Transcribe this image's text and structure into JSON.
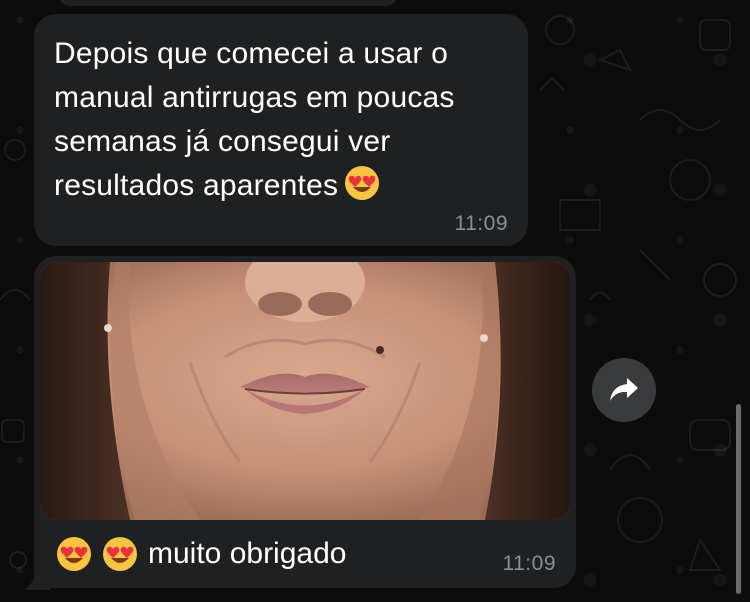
{
  "chat": {
    "messages": [
      {
        "text": "Depois que comecei a usar o manual antirrugas em poucas semanas já consegui ver resultados aparentes",
        "emoji": "smiling-face-with-heart-eyes",
        "time": "11:09"
      },
      {
        "type": "image",
        "caption_emojis": [
          "smiling-face-with-heart-eyes",
          "smiling-face-with-heart-eyes"
        ],
        "caption": "muito obrigado",
        "time": "11:09"
      }
    ],
    "forward_icon": "forward-arrow-icon"
  },
  "colors": {
    "bubble": "#1f2021",
    "text": "#ffffff",
    "timestamp": "#8d8f91",
    "forward_button": "#3a3b3c"
  }
}
